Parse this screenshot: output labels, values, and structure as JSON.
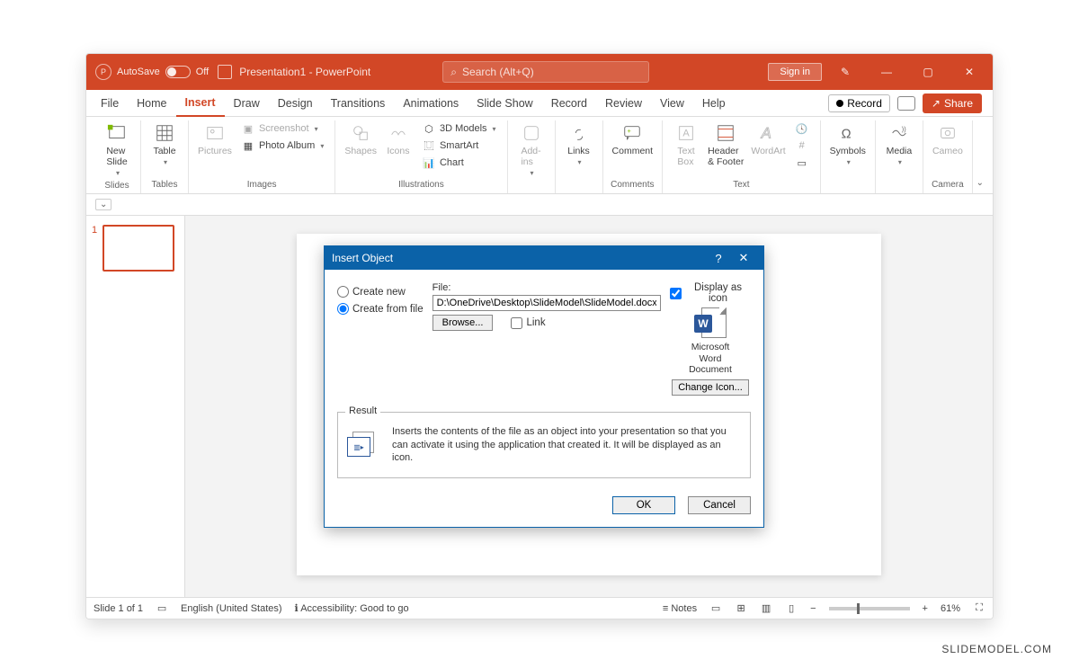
{
  "titlebar": {
    "autosave_label": "AutoSave",
    "autosave_state": "Off",
    "doc_title": "Presentation1 - PowerPoint",
    "search_placeholder": "Search (Alt+Q)",
    "signin": "Sign in"
  },
  "menu": {
    "tabs": [
      "File",
      "Home",
      "Insert",
      "Draw",
      "Design",
      "Transitions",
      "Animations",
      "Slide Show",
      "Record",
      "Review",
      "View",
      "Help"
    ],
    "active": "Insert",
    "record": "Record",
    "share": "Share"
  },
  "ribbon": {
    "groups": {
      "slides": {
        "label": "Slides",
        "new_slide": "New\nSlide"
      },
      "tables": {
        "label": "Tables",
        "table": "Table"
      },
      "images": {
        "label": "Images",
        "pictures": "Pictures",
        "screenshot": "Screenshot",
        "photo_album": "Photo Album"
      },
      "illustrations": {
        "label": "Illustrations",
        "shapes": "Shapes",
        "icons": "Icons",
        "models": "3D Models",
        "smartart": "SmartArt",
        "chart": "Chart"
      },
      "addins": {
        "label": "",
        "addins": "Add-\nins"
      },
      "links": {
        "label": "",
        "links": "Links"
      },
      "comments": {
        "label": "Comments",
        "comment": "Comment"
      },
      "text": {
        "label": "Text",
        "textbox": "Text\nBox",
        "header": "Header\n& Footer",
        "wordart": "WordArt",
        "extra": ""
      },
      "symbols": {
        "label": "",
        "symbols": "Symbols"
      },
      "media": {
        "label": "",
        "media": "Media"
      },
      "camera": {
        "label": "Camera",
        "cameo": "Cameo"
      }
    }
  },
  "thumbs": {
    "num": "1"
  },
  "dialog": {
    "title": "Insert Object",
    "create_new": "Create new",
    "create_from_file": "Create from file",
    "file_label": "File:",
    "file_value": "D:\\OneDrive\\Desktop\\SlideModel\\SlideModel.docx",
    "browse": "Browse...",
    "link": "Link",
    "display_as_icon": "Display as icon",
    "icon_caption": "Microsoft\nWord\nDocument",
    "change_icon": "Change Icon...",
    "result_label": "Result",
    "result_text": "Inserts the contents of the file as an object into your presentation so that you can activate it using the application that created it. It will be displayed as an icon.",
    "ok": "OK",
    "cancel": "Cancel"
  },
  "statusbar": {
    "slide": "Slide 1 of 1",
    "lang": "English (United States)",
    "access": "Accessibility: Good to go",
    "notes": "Notes",
    "zoom": "61%"
  },
  "watermark": "SLIDEMODEL.COM"
}
